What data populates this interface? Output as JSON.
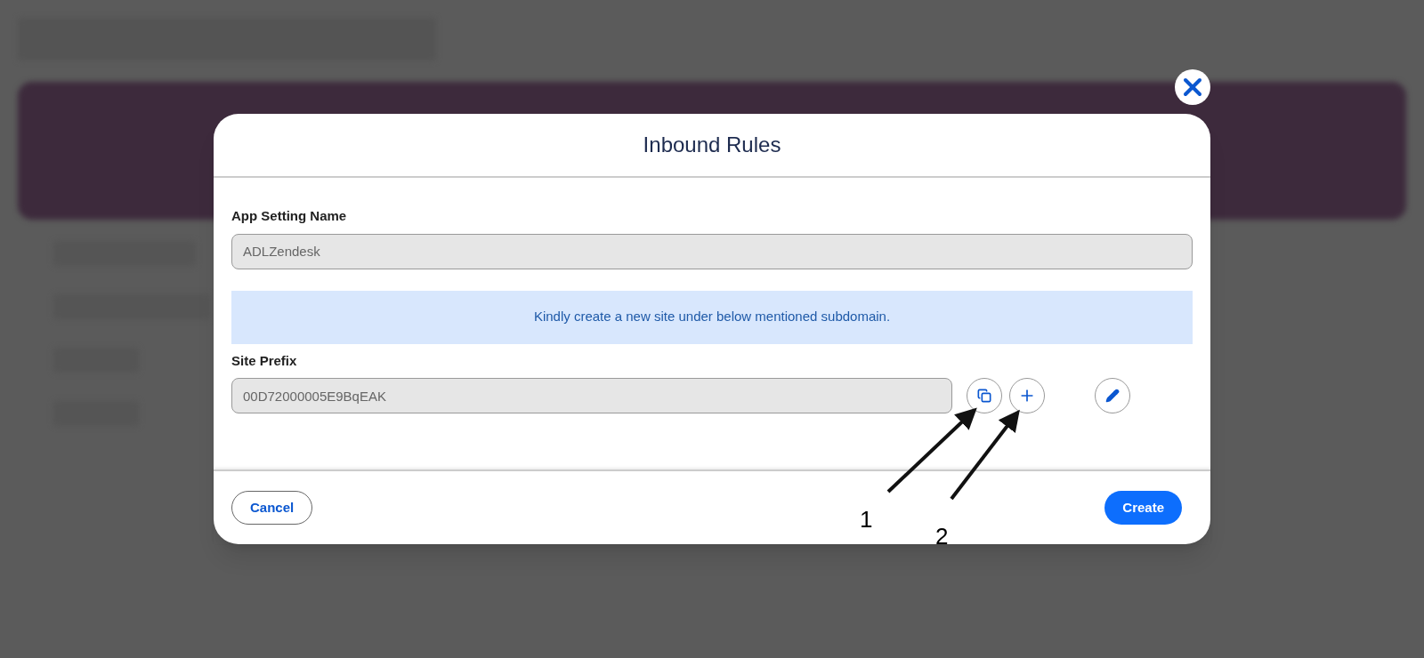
{
  "dialog": {
    "title": "Inbound Rules",
    "app_setting": {
      "label": "App Setting Name",
      "value": "ADLZendesk",
      "disabled": true
    },
    "info_message": "Kindly create a new site under below mentioned subdomain.",
    "site_prefix": {
      "label": "Site Prefix",
      "value": "00D72000005E9BqEAK",
      "disabled": true
    },
    "icon_buttons": [
      {
        "kind": "copy"
      },
      {
        "kind": "add"
      },
      {
        "kind": "edit"
      }
    ],
    "buttons": [
      {
        "label": "Cancel",
        "kind": "secondary"
      },
      {
        "label": "Create",
        "kind": "primary"
      }
    ]
  },
  "annotations": [
    {
      "label": "1"
    },
    {
      "label": "2"
    }
  ]
}
